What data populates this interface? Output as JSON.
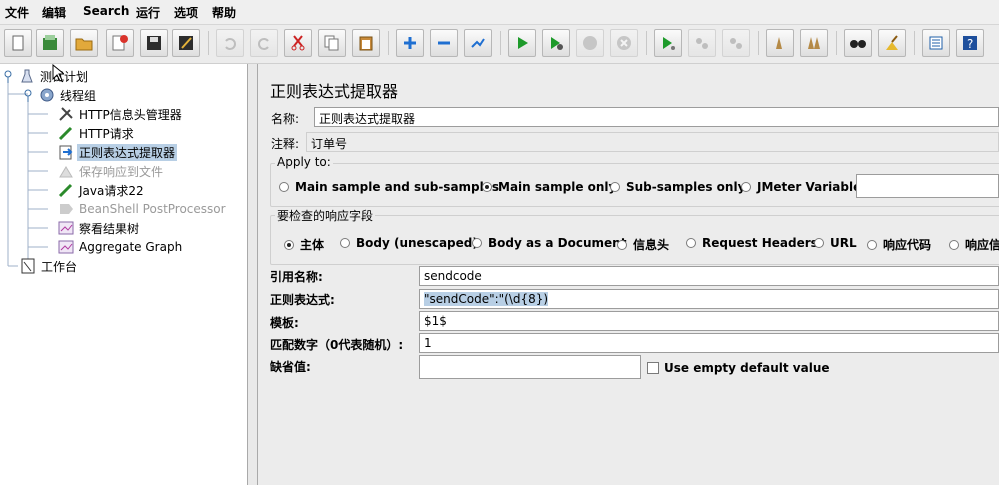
{
  "menu": [
    "文件",
    "编辑",
    "Search",
    "运行",
    "选项",
    "帮助"
  ],
  "toolbar_icons": [
    "new-icon",
    "templates-icon",
    "open-icon",
    "close-icon",
    "save-icon",
    "save-as-icon",
    "undo-icon",
    "redo-icon",
    "cut-icon",
    "copy-icon",
    "paste-icon",
    "expand-icon",
    "collapse-icon",
    "toggle-icon",
    "start-icon",
    "start-no-pause-icon",
    "stop-icon",
    "shutdown-icon",
    "remote-start-icon",
    "remote-stop-icon",
    "remote-exit-icon",
    "clear-icon",
    "clear-all-icon",
    "search-icon",
    "reset-search-icon",
    "function-helper-icon",
    "help-icon"
  ],
  "tree": [
    {
      "label": "测试计划"
    },
    {
      "label": "线程组"
    },
    {
      "label": "HTTP信息头管理器"
    },
    {
      "label": "HTTP请求"
    },
    {
      "label": "正则表达式提取器"
    },
    {
      "label": "保存响应到文件"
    },
    {
      "label": "Java请求22"
    },
    {
      "label": "BeanShell PostProcessor"
    },
    {
      "label": "察看结果树"
    },
    {
      "label": "Aggregate Graph"
    },
    {
      "label": "工作台"
    }
  ],
  "panel": {
    "title": "正则表达式提取器",
    "name_label": "名称:",
    "name_value": "正则表达式提取器",
    "comment_label": "注释:",
    "comment_value": "订单号",
    "apply_to": {
      "title": "Apply to:",
      "options": [
        "Main sample and sub-samples",
        "Main sample only",
        "Sub-samples only",
        "JMeter Variable"
      ],
      "selected": "Main sample only",
      "variable_value": ""
    },
    "response_field": {
      "title": "要检查的响应字段",
      "options": [
        "主体",
        "Body (unescaped)",
        "Body as a Document",
        "信息头",
        "Request Headers",
        "URL",
        "响应代码",
        "响应信息"
      ],
      "selected": "主体"
    },
    "ref_name_label": "引用名称:",
    "ref_name_value": "sendcode",
    "regex_label": "正则表达式:",
    "regex_value": "\"sendCode\":\"(\\d{8})",
    "template_label": "模板:",
    "template_value": "$1$",
    "match_label": "匹配数字（0代表随机）:",
    "match_value": "1",
    "default_label": "缺省值:",
    "default_value": "",
    "use_empty_label": "Use empty default value"
  }
}
